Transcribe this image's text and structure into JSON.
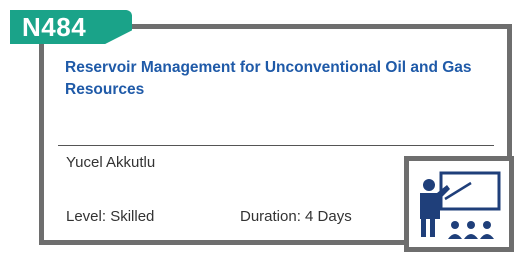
{
  "course": {
    "code": "N484",
    "title": "Reservoir Management for Unconventional Oil and Gas Resources",
    "instructor": "Yucel Akkutlu",
    "level": "Level: Skilled",
    "duration": "Duration: 4 Days"
  },
  "icons": {
    "training": "presentation-trainer-icon"
  },
  "colors": {
    "accent": "#1aa389",
    "title": "#1f5aa8",
    "border": "#6e6e6e",
    "icon_blue": "#1f3f7a"
  }
}
